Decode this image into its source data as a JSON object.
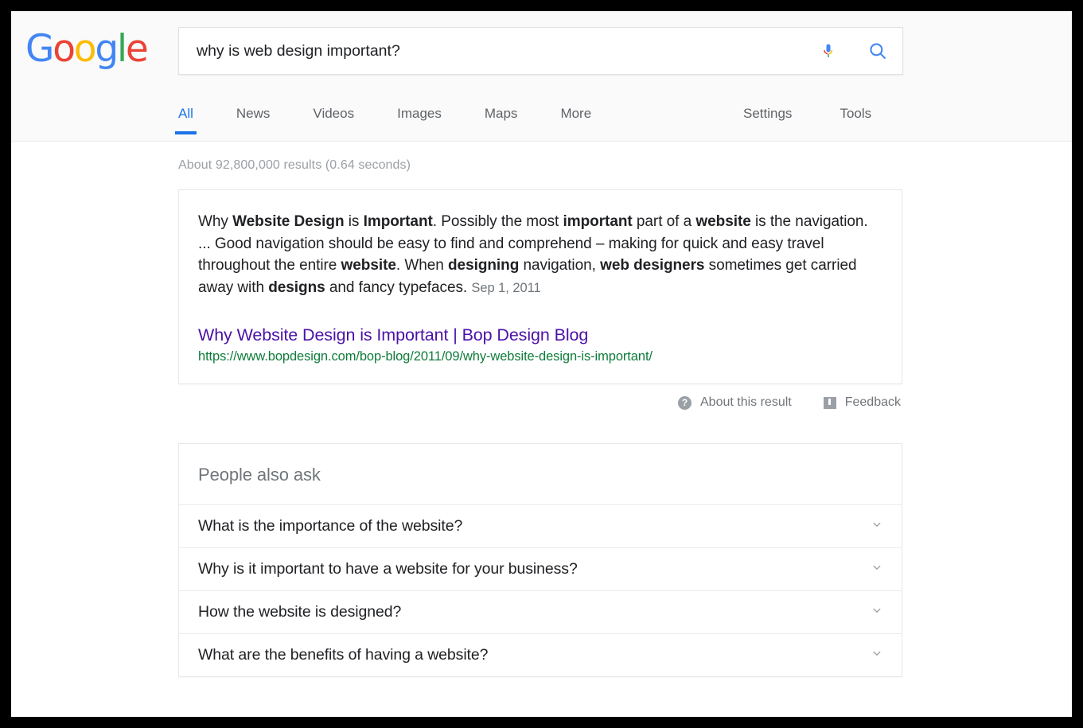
{
  "logo": {
    "letters": [
      {
        "char": "G",
        "color": "#4285f4"
      },
      {
        "char": "o",
        "color": "#ea4335"
      },
      {
        "char": "o",
        "color": "#fbbc05"
      },
      {
        "char": "g",
        "color": "#4285f4"
      },
      {
        "char": "l",
        "color": "#34a853"
      },
      {
        "char": "e",
        "color": "#ea4335"
      }
    ],
    "alt": "Google"
  },
  "search": {
    "query": "why is web design important?",
    "placeholder": "Search",
    "mic_icon": "microphone-icon",
    "search_icon": "search-icon"
  },
  "nav": {
    "left_tabs": [
      {
        "label": "All",
        "active": true
      },
      {
        "label": "News",
        "active": false
      },
      {
        "label": "Videos",
        "active": false
      },
      {
        "label": "Images",
        "active": false
      },
      {
        "label": "Maps",
        "active": false
      },
      {
        "label": "More",
        "active": false
      }
    ],
    "right_tabs": [
      {
        "label": "Settings"
      },
      {
        "label": "Tools"
      }
    ]
  },
  "results": {
    "stats": "About 92,800,000 results (0.64 seconds)",
    "featured_snippet": {
      "paragraph_parts": [
        {
          "text": "Why ",
          "bold": false
        },
        {
          "text": "Website Design",
          "bold": true
        },
        {
          "text": " is ",
          "bold": false
        },
        {
          "text": "Important",
          "bold": true
        },
        {
          "text": ". Possibly the most ",
          "bold": false
        },
        {
          "text": "important",
          "bold": true
        },
        {
          "text": " part of a ",
          "bold": false
        },
        {
          "text": "website",
          "bold": true
        },
        {
          "text": " is the navigation. ... Good navigation should be easy to find and comprehend – making for quick and easy travel throughout the entire ",
          "bold": false
        },
        {
          "text": "website",
          "bold": true
        },
        {
          "text": ". When ",
          "bold": false
        },
        {
          "text": "designing",
          "bold": true
        },
        {
          "text": " navigation, ",
          "bold": false
        },
        {
          "text": "web designers",
          "bold": true
        },
        {
          "text": " sometimes get carried away with ",
          "bold": false
        },
        {
          "text": "designs",
          "bold": true
        },
        {
          "text": " and fancy typefaces. ",
          "bold": false
        }
      ],
      "date": "Sep 1, 2011",
      "title": "Why Website Design is Important | Bop Design Blog",
      "url": "https://www.bopdesign.com/bop-blog/2011/09/why-website-design-is-important/"
    },
    "meta": {
      "about_icon": "question-mark-circle-icon",
      "about_label": "About this result",
      "feedback_icon": "feedback-flag-icon",
      "feedback_label": "Feedback"
    }
  },
  "people_also_ask": {
    "header": "People also ask",
    "expand_icon": "chevron-down-icon",
    "questions": [
      {
        "question": "What is the importance of the website?"
      },
      {
        "question": "Why is it important to have a website for your business?"
      },
      {
        "question": "How the website is designed?"
      },
      {
        "question": "What are the benefits of having a website?"
      }
    ]
  },
  "colors": {
    "accent_blue": "#1a73e8",
    "link_purple": "#4b11a8",
    "url_green": "#0e7c3a",
    "text_gray": "#70757a",
    "google_blue": "#4285f4",
    "google_red": "#ea4335",
    "google_yellow": "#fbbc05",
    "google_green": "#34a853"
  }
}
